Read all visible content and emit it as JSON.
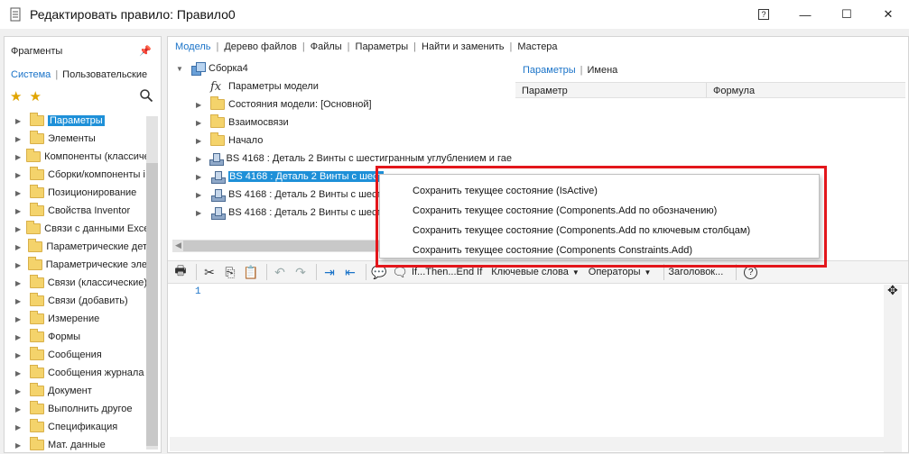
{
  "window": {
    "title": "Редактировать правило: Правило0",
    "help_label": "?",
    "minimize_label": "—",
    "maximize_label": "☐",
    "close_label": "✕"
  },
  "fragments": {
    "title": "Фрагменты",
    "tabs": [
      "Система",
      "Пользовательские"
    ],
    "items": [
      {
        "label": "Параметры",
        "selected": true
      },
      {
        "label": "Элементы"
      },
      {
        "label": "Компоненты (классиче"
      },
      {
        "label": "Сборки/компоненты i"
      },
      {
        "label": "Позиционирование"
      },
      {
        "label": "Свойства Inventor"
      },
      {
        "label": "Связи с данными Exce"
      },
      {
        "label": "Параметрические дет"
      },
      {
        "label": "Параметрические эле"
      },
      {
        "label": "Связи (классические)"
      },
      {
        "label": "Связи (добавить)"
      },
      {
        "label": "Измерение"
      },
      {
        "label": "Формы"
      },
      {
        "label": "Сообщения"
      },
      {
        "label": "Сообщения журнала"
      },
      {
        "label": "Документ"
      },
      {
        "label": "Выполнить другое"
      },
      {
        "label": "Спецификация"
      },
      {
        "label": "Мат. данные"
      }
    ]
  },
  "main_tabs": [
    "Модель",
    "Дерево файлов",
    "Файлы",
    "Параметры",
    "Найти и заменить",
    "Мастера"
  ],
  "model_tree": {
    "root": "Сборка4",
    "items": [
      {
        "label": "Параметры модели",
        "icon": "fx-icon",
        "expander": false
      },
      {
        "label": "Состояния модели: [Основной]",
        "icon": "folder-icon",
        "expander": true
      },
      {
        "label": "Взаимосвязи",
        "icon": "folder-icon",
        "expander": true
      },
      {
        "label": "Начало",
        "icon": "folder-icon",
        "expander": true
      },
      {
        "label": "BS 4168 : Деталь 2 Винты с шестигранным углублением и гае",
        "icon": "part-icon",
        "expander": true
      },
      {
        "label": "BS 4168 : Деталь 2 Винты с шест",
        "icon": "part-icon",
        "expander": true,
        "selected": true
      },
      {
        "label": "BS 4168 : Деталь 2 Винты с шест",
        "icon": "part-icon",
        "expander": true
      },
      {
        "label": "BS 4168 : Деталь 2 Винты с шест",
        "icon": "part-icon",
        "expander": true
      }
    ]
  },
  "params_panel": {
    "tabs": [
      "Параметры",
      "Имена"
    ],
    "columns": [
      "Параметр",
      "Формула"
    ]
  },
  "toolbar": {
    "dropdowns": [
      "If...Then...End If",
      "Ключевые слова",
      "Операторы",
      "Заголовок..."
    ]
  },
  "editor": {
    "line_numbers": [
      "1"
    ]
  },
  "context_menu": {
    "items": [
      "Сохранить текущее состояние (IsActive)",
      "Сохранить текущее состояние (Components.Add по обозначению)",
      "Сохранить текущее состояние (Components.Add по ключевым столбцам)",
      "Сохранить текущее состояние (Components Constraints.Add)"
    ]
  },
  "colors": {
    "accent": "#1a73c8",
    "selection": "#1e90d8",
    "highlight": "#e3161b"
  }
}
